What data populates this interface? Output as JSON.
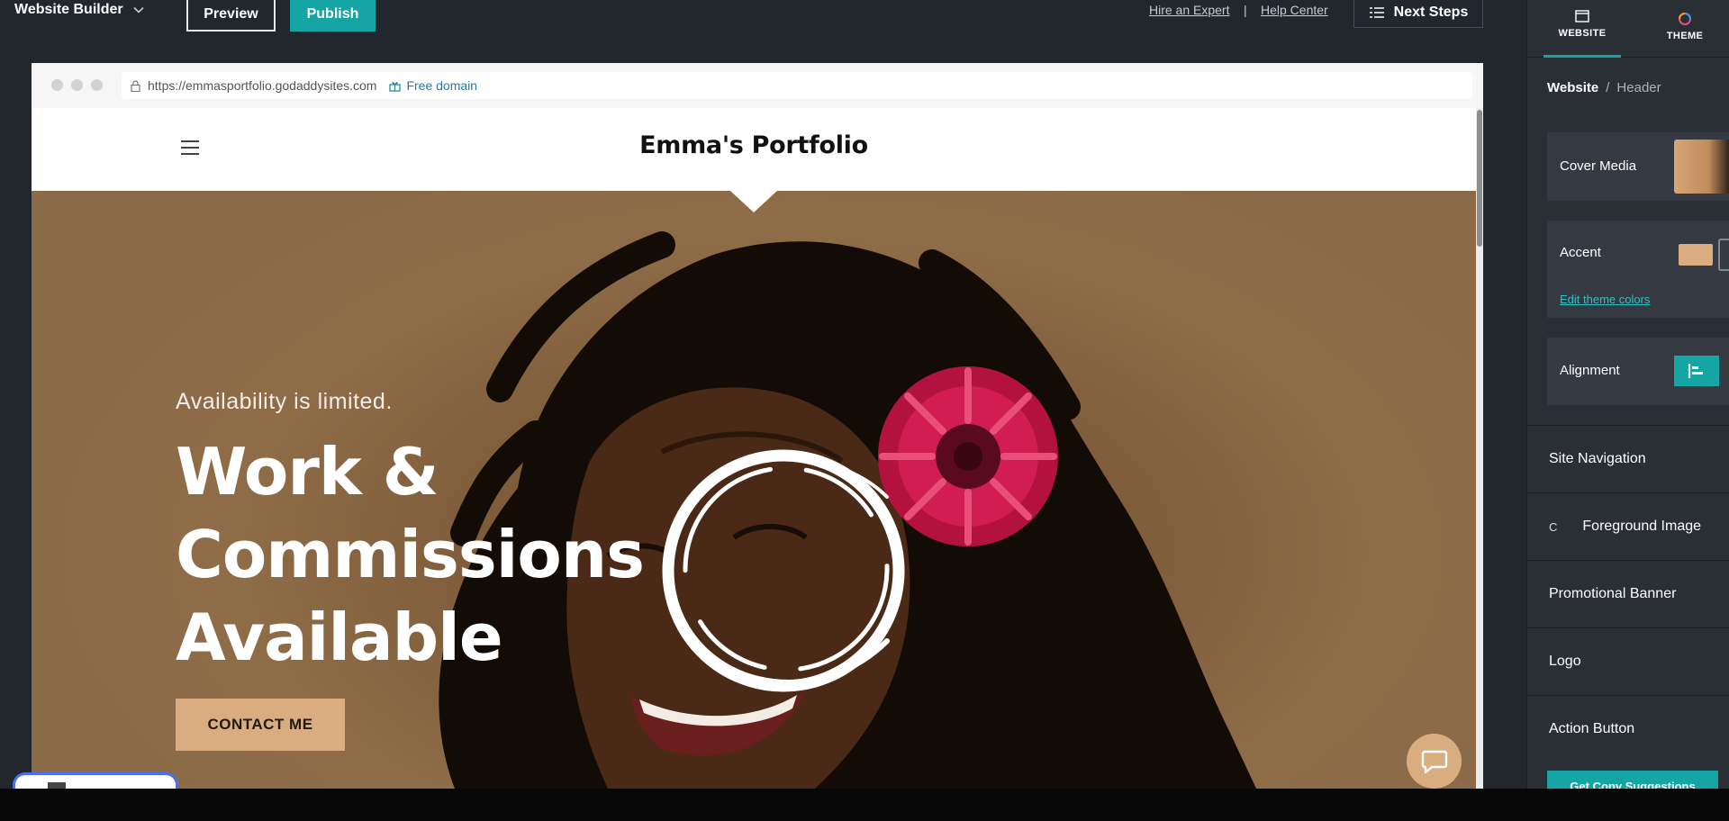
{
  "topbar": {
    "app_name": "Website Builder",
    "app_menu_icon": "chevron-down-icon",
    "preview_label": "Preview",
    "publish_label": "Publish",
    "hire_expert_label": "Hire an Expert",
    "separator": "|",
    "help_center_label": "Help Center",
    "next_steps_label": "Next Steps",
    "next_steps_icon": "list-icon"
  },
  "browser": {
    "url": "https://emmasportfolio.godaddysites.com",
    "free_domain_label": "Free domain",
    "lock_icon": "lock-icon",
    "free_domain_icon": "gift-icon"
  },
  "site": {
    "title": "Emma's Portfolio",
    "menu_icon": "hamburger-icon",
    "hero": {
      "subtitle": "Availability is limited.",
      "title_line1": "Work &",
      "title_line2": "Commissions",
      "title_line3": "Available",
      "cta_label": "CONTACT ME"
    },
    "chat_icon": "chat-bubble-icon"
  },
  "panel": {
    "tabs": [
      {
        "label": "WEBSITE",
        "icon": "window-icon",
        "active": true
      },
      {
        "label": "THEME",
        "icon": "palette-icon",
        "active": false
      }
    ],
    "breadcrumb": {
      "root": "Website",
      "separator": "/",
      "current": "Header"
    },
    "cover_media_label": "Cover Media",
    "accent_label": "Accent",
    "accent_color": "#d9ad7f",
    "edit_theme_label": "Edit theme colors",
    "alignment_label": "Alignment",
    "alignment_icon": "align-left-icon",
    "items": [
      {
        "label": "Site Navigation"
      },
      {
        "label": "Foreground Image",
        "icon_glyph": "C"
      },
      {
        "label": "Promotional Banner"
      },
      {
        "label": "Logo"
      },
      {
        "label": "Action Button"
      }
    ],
    "get_copy_label": "Get Copy Suggestions"
  },
  "colors": {
    "editor_bg": "#22262d",
    "panel_bg": "#2a2e35",
    "brand_teal": "#16a5a5",
    "accent_tan": "#d9ad7f"
  }
}
